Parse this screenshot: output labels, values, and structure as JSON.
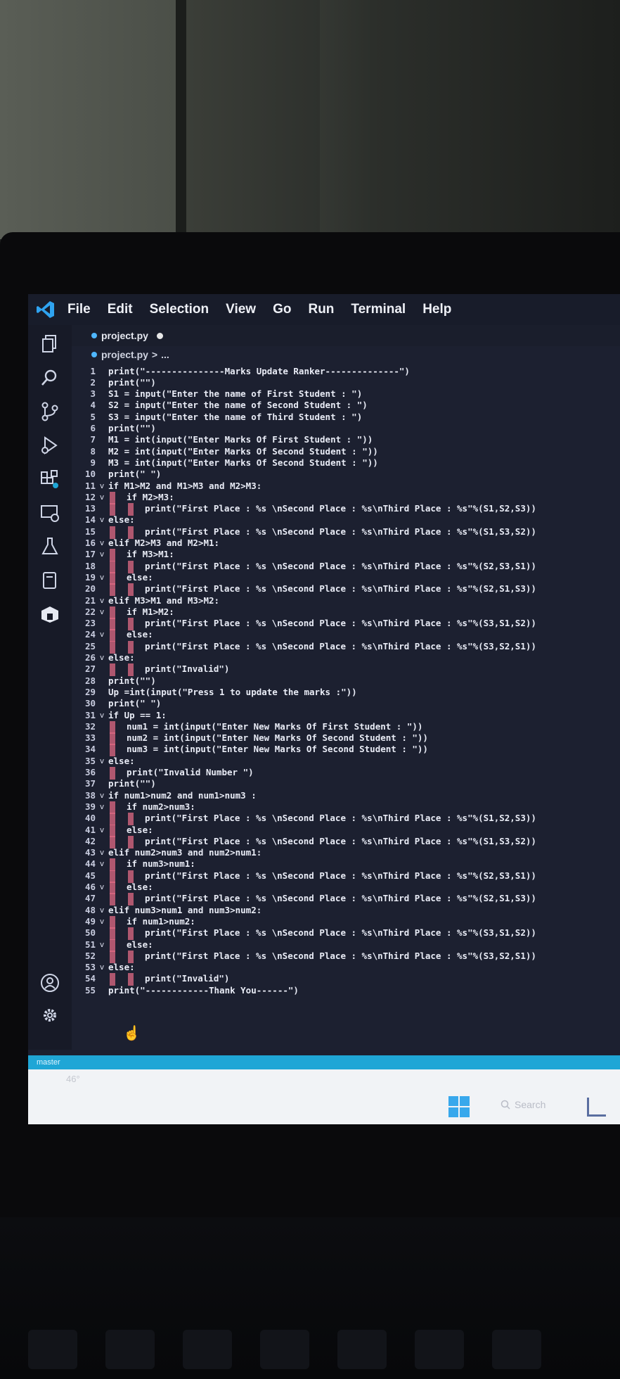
{
  "menu": {
    "items": [
      "File",
      "Edit",
      "Selection",
      "View",
      "Go",
      "Run",
      "Terminal",
      "Help"
    ]
  },
  "tab": {
    "filename": "project.py"
  },
  "breadcrumb": {
    "file": "project.py",
    "separator": ">",
    "rest": "..."
  },
  "activity_icons": [
    "explorer-icon",
    "search-icon",
    "source-control-icon",
    "run-debug-icon",
    "extensions-icon",
    "remote-explorer-icon",
    "testing-icon",
    "notebook-icon",
    "deploy-icon",
    "account-icon",
    "settings-gear-icon"
  ],
  "code_lines": [
    {
      "n": "1",
      "t": "print(\"---------------Marks Update Ranker--------------\")",
      "fold": "",
      "indent": 0
    },
    {
      "n": "2",
      "t": "print(\"\")",
      "fold": "",
      "indent": 0
    },
    {
      "n": "3",
      "t": "S1 = input(\"Enter the name of First Student : \")",
      "fold": "",
      "indent": 0
    },
    {
      "n": "4",
      "t": "S2 = input(\"Enter the name of Second Student : \")",
      "fold": "",
      "indent": 0
    },
    {
      "n": "5",
      "t": "S3 = input(\"Enter the name of Third Student : \")",
      "fold": "",
      "indent": 0
    },
    {
      "n": "6",
      "t": "print(\"\")",
      "fold": "",
      "indent": 0
    },
    {
      "n": "7",
      "t": "M1 = int(input(\"Enter Marks Of First Student : \"))",
      "fold": "",
      "indent": 0
    },
    {
      "n": "8",
      "t": "M2 = int(input(\"Enter Marks Of Second Student : \"))",
      "fold": "",
      "indent": 0
    },
    {
      "n": "9",
      "t": "M3 = int(input(\"Enter Marks Of Second Student : \"))",
      "fold": "",
      "indent": 0
    },
    {
      "n": "10",
      "t": "print(\" \")",
      "fold": "",
      "indent": 0
    },
    {
      "n": "11",
      "t": "if M1>M2 and M1>M3 and M2>M3:",
      "fold": "v",
      "indent": 0
    },
    {
      "n": "12",
      "t": "if M2>M3:",
      "fold": "v",
      "indent": 1
    },
    {
      "n": "13",
      "t": "print(\"First Place : %s \\nSecond Place : %s\\nThird Place : %s\"%(S1,S2,S3))",
      "fold": "",
      "indent": 2
    },
    {
      "n": "14",
      "t": "else:",
      "fold": "v",
      "indent": 0
    },
    {
      "n": "15",
      "t": "print(\"First Place : %s \\nSecond Place : %s\\nThird Place : %s\"%(S1,S3,S2))",
      "fold": "",
      "indent": 2
    },
    {
      "n": "16",
      "t": "elif M2>M3 and M2>M1:",
      "fold": "v",
      "indent": 0
    },
    {
      "n": "17",
      "t": "if M3>M1:",
      "fold": "v",
      "indent": 1
    },
    {
      "n": "18",
      "t": "print(\"First Place : %s \\nSecond Place : %s\\nThird Place : %s\"%(S2,S3,S1))",
      "fold": "",
      "indent": 2
    },
    {
      "n": "19",
      "t": "else:",
      "fold": "v",
      "indent": 1
    },
    {
      "n": "20",
      "t": "print(\"First Place : %s \\nSecond Place : %s\\nThird Place : %s\"%(S2,S1,S3))",
      "fold": "",
      "indent": 2
    },
    {
      "n": "21",
      "t": "elif M3>M1 and M3>M2:",
      "fold": "v",
      "indent": 0
    },
    {
      "n": "22",
      "t": "if M1>M2:",
      "fold": "v",
      "indent": 1
    },
    {
      "n": "23",
      "t": "print(\"First Place : %s \\nSecond Place : %s\\nThird Place : %s\"%(S3,S1,S2))",
      "fold": "",
      "indent": 2
    },
    {
      "n": "24",
      "t": "else:",
      "fold": "v",
      "indent": 1
    },
    {
      "n": "25",
      "t": "print(\"First Place : %s \\nSecond Place : %s\\nThird Place : %s\"%(S3,S2,S1))",
      "fold": "",
      "indent": 2
    },
    {
      "n": "26",
      "t": "else:",
      "fold": "v",
      "indent": 0
    },
    {
      "n": "27",
      "t": "print(\"Invalid\")",
      "fold": "",
      "indent": 2
    },
    {
      "n": "28",
      "t": "print(\"\")",
      "fold": "",
      "indent": 0
    },
    {
      "n": "29",
      "t": "Up =int(input(\"Press 1 to update the marks :\"))",
      "fold": "",
      "indent": 0
    },
    {
      "n": "30",
      "t": "print(\" \")",
      "fold": "",
      "indent": 0
    },
    {
      "n": "31",
      "t": "if Up == 1:",
      "fold": "v",
      "indent": 0
    },
    {
      "n": "32",
      "t": "num1 = int(input(\"Enter New Marks Of First Student : \"))",
      "fold": "",
      "indent": 1
    },
    {
      "n": "33",
      "t": "num2 = int(input(\"Enter New Marks Of Second Student : \"))",
      "fold": "",
      "indent": 1
    },
    {
      "n": "34",
      "t": "num3 = int(input(\"Enter New Marks Of Second Student : \"))",
      "fold": "",
      "indent": 1
    },
    {
      "n": "35",
      "t": "else:",
      "fold": "v",
      "indent": 0
    },
    {
      "n": "36",
      "t": "print(\"Invalid Number \")",
      "fold": "",
      "indent": 1
    },
    {
      "n": "37",
      "t": "print(\"\")",
      "fold": "",
      "indent": 0
    },
    {
      "n": "38",
      "t": "if num1>num2 and num1>num3 :",
      "fold": "v",
      "indent": 0
    },
    {
      "n": "39",
      "t": "if num2>num3:",
      "fold": "v",
      "indent": 1
    },
    {
      "n": "40",
      "t": "print(\"First Place : %s \\nSecond Place : %s\\nThird Place : %s\"%(S1,S2,S3))",
      "fold": "",
      "indent": 2
    },
    {
      "n": "41",
      "t": "else:",
      "fold": "v",
      "indent": 1
    },
    {
      "n": "42",
      "t": "print(\"First Place : %s \\nSecond Place : %s\\nThird Place : %s\"%(S1,S3,S2))",
      "fold": "",
      "indent": 2
    },
    {
      "n": "43",
      "t": "elif num2>num3 and num2>num1:",
      "fold": "v",
      "indent": 0
    },
    {
      "n": "44",
      "t": "if num3>num1:",
      "fold": "v",
      "indent": 1
    },
    {
      "n": "45",
      "t": "print(\"First Place : %s \\nSecond Place : %s\\nThird Place : %s\"%(S2,S3,S1))",
      "fold": "",
      "indent": 2
    },
    {
      "n": "46",
      "t": "else:",
      "fold": "v",
      "indent": 1
    },
    {
      "n": "47",
      "t": "print(\"First Place : %s \\nSecond Place : %s\\nThird Place : %s\"%(S2,S1,S3))",
      "fold": "",
      "indent": 2
    },
    {
      "n": "48",
      "t": "elif num3>num1 and num3>num2:",
      "fold": "v",
      "indent": 0
    },
    {
      "n": "49",
      "t": "if num1>num2:",
      "fold": "v",
      "indent": 1
    },
    {
      "n": "50",
      "t": "print(\"First Place : %s \\nSecond Place : %s\\nThird Place : %s\"%(S3,S1,S2))",
      "fold": "",
      "indent": 2
    },
    {
      "n": "51",
      "t": "else:",
      "fold": "v",
      "indent": 1
    },
    {
      "n": "52",
      "t": "print(\"First Place : %s \\nSecond Place : %s\\nThird Place : %s\"%(S3,S2,S1))",
      "fold": "",
      "indent": 2
    },
    {
      "n": "53",
      "t": "else:",
      "fold": "v",
      "indent": 0
    },
    {
      "n": "54",
      "t": "print(\"Invalid\")",
      "fold": "",
      "indent": 2
    },
    {
      "n": "55",
      "t": "print(\"------------Thank You------\")",
      "fold": "",
      "indent": 0
    }
  ],
  "statusbar": {
    "branch": "master"
  },
  "taskbar": {
    "temperature": "46°",
    "search": "Search"
  },
  "colors": {
    "accent": "#1fa6d6",
    "indent_guide": "#e06a84",
    "editor_bg": "#1c2030"
  }
}
